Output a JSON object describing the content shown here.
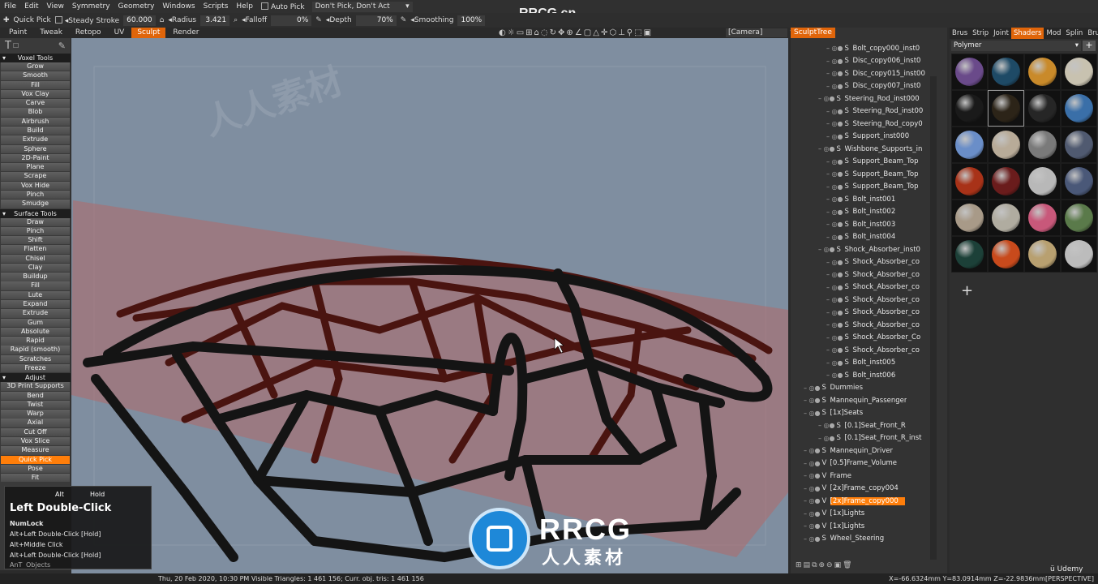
{
  "menubar": {
    "items": [
      "File",
      "Edit",
      "View",
      "Symmetry",
      "Geometry",
      "Windows",
      "Scripts",
      "Help"
    ],
    "auto_pick": "Auto Pick",
    "pick_mode": "Don't Pick, Don't Act"
  },
  "toolbar": {
    "quick_pick": "Quick Pick",
    "steady_stroke": "Steady Stroke",
    "steady_value": "60.000",
    "radius_label": "Radius",
    "radius_value": "3.421",
    "falloff_label": "Falloff",
    "falloff_value": "0%",
    "depth_label": "Depth",
    "depth_value": "70%",
    "smoothing_label": "Smoothing",
    "smoothing_value": "100%"
  },
  "watermark": "RRCG.cn",
  "rooms": [
    "Paint",
    "Tweak",
    "Retopo",
    "UV",
    "Sculpt",
    "Render"
  ],
  "active_room": "Sculpt",
  "camera": "[Camera]",
  "voxel_tools": {
    "title": "Voxel Tools",
    "items": [
      "Grow",
      "Smooth",
      "Fill",
      "Vox Clay",
      "Carve",
      "Blob",
      "Airbrush",
      "Build",
      "Extrude",
      "Sphere",
      "2D-Paint",
      "Plane",
      "Scrape",
      "Vox Hide",
      "Pinch",
      "Smudge"
    ]
  },
  "surface_tools": {
    "title": "Surface Tools",
    "items": [
      "Draw",
      "Pinch",
      "Shift",
      "Flatten",
      "Chisel",
      "Clay",
      "Buildup",
      "Fill",
      "Lute",
      "Expand",
      "Extrude",
      "Gum",
      "Absolute",
      "Rapid",
      "Rapid (smooth)",
      "Scratches",
      "Freeze"
    ]
  },
  "adjust": {
    "title": "Adjust",
    "items": [
      "3D Print Supports",
      "Bend",
      "Twist",
      "Warp",
      "Axial",
      "Cut Off",
      "Vox Slice",
      "Measure",
      "Quick Pick",
      "Pose",
      "Fit"
    ]
  },
  "active_tool": "Quick Pick",
  "hint": {
    "header_left": "Alt",
    "header_right": "Hold",
    "title": "Left Double-Click",
    "lines": [
      "NumLock",
      "Alt+Left Double-Click [Hold]",
      "Alt+Middle Click",
      "Alt+Left Double-Click [Hold]"
    ],
    "footer": "Objects",
    "corner": "AnT"
  },
  "status": {
    "left": "Thu, 20 Feb 2020, 10:30 PM     Visible Triangles: 1 461 156; Curr. obj. tris: 1 461 156",
    "right": "X=-66.6324mm  Y=83.0914mm  Z=-22.9836mm[PERSPECTIVE]"
  },
  "sculpt_tree": {
    "tab": "SculptTree",
    "rows": [
      {
        "name": "Bolt_copy000_inst0",
        "mode": "S",
        "indent": 2
      },
      {
        "name": "Disc_copy006_inst0",
        "mode": "S",
        "indent": 2
      },
      {
        "name": "Disc_copy015_inst00",
        "mode": "S",
        "indent": 2
      },
      {
        "name": "Disc_copy007_inst0",
        "mode": "S",
        "indent": 2
      },
      {
        "name": "Steering_Rod_inst000",
        "mode": "S",
        "indent": 1
      },
      {
        "name": "Steering_Rod_inst00",
        "mode": "S",
        "indent": 2
      },
      {
        "name": "Steering_Rod_copy0",
        "mode": "S",
        "indent": 2
      },
      {
        "name": "Support_inst000",
        "mode": "S",
        "indent": 2
      },
      {
        "name": "Wishbone_Supports_in",
        "mode": "S",
        "indent": 1
      },
      {
        "name": "Support_Beam_Top",
        "mode": "S",
        "indent": 2
      },
      {
        "name": "Support_Beam_Top",
        "mode": "S",
        "indent": 2
      },
      {
        "name": "Support_Beam_Top",
        "mode": "S",
        "indent": 2
      },
      {
        "name": "Bolt_inst001",
        "mode": "S",
        "indent": 2
      },
      {
        "name": "Bolt_inst002",
        "mode": "S",
        "indent": 2
      },
      {
        "name": "Bolt_inst003",
        "mode": "S",
        "indent": 2
      },
      {
        "name": "Bolt_inst004",
        "mode": "S",
        "indent": 2
      },
      {
        "name": "Shock_Absorber_inst0",
        "mode": "S",
        "indent": 1
      },
      {
        "name": "Shock_Absorber_co",
        "mode": "S",
        "indent": 2
      },
      {
        "name": "Shock_Absorber_co",
        "mode": "S",
        "indent": 2
      },
      {
        "name": "Shock_Absorber_co",
        "mode": "S",
        "indent": 2
      },
      {
        "name": "Shock_Absorber_co",
        "mode": "S",
        "indent": 2
      },
      {
        "name": "Shock_Absorber_co",
        "mode": "S",
        "indent": 2
      },
      {
        "name": "Shock_Absorber_co",
        "mode": "S",
        "indent": 2
      },
      {
        "name": "Shock_Absorber_Co",
        "mode": "S",
        "indent": 2
      },
      {
        "name": "Shock_Absorber_co",
        "mode": "S",
        "indent": 2
      },
      {
        "name": "Bolt_inst005",
        "mode": "S",
        "indent": 2
      },
      {
        "name": "Bolt_inst006",
        "mode": "S",
        "indent": 2
      },
      {
        "name": "Dummies",
        "mode": "S",
        "indent": 0
      },
      {
        "name": "Mannequin_Passenger",
        "mode": "S",
        "indent": 0
      },
      {
        "name": "[1x]Seats",
        "mode": "S",
        "indent": 0
      },
      {
        "name": "[0.1]Seat_Front_R",
        "mode": "S",
        "indent": 1
      },
      {
        "name": "[0.1]Seat_Front_R_inst",
        "mode": "S",
        "indent": 1
      },
      {
        "name": "Mannequin_Driver",
        "mode": "S",
        "indent": 0
      },
      {
        "name": "[0.5]Frame_Volume",
        "mode": "V",
        "indent": 0
      },
      {
        "name": "Frame",
        "mode": "V",
        "indent": 0
      },
      {
        "name": "[2x]Frame_copy004",
        "mode": "V",
        "indent": 0
      },
      {
        "name": "[2x]Frame_copy000",
        "mode": "V",
        "indent": 0,
        "selected": true
      },
      {
        "name": "[1x]Lights",
        "mode": "V",
        "indent": 0
      },
      {
        "name": "[1x]Lights",
        "mode": "V",
        "indent": 0
      },
      {
        "name": "Wheel_Steering",
        "mode": "S",
        "indent": 0
      }
    ]
  },
  "shaders": {
    "tabs": [
      "Brus",
      "Strip",
      "Joint",
      "Shaders",
      "Mod",
      "Splin",
      "Brus"
    ],
    "active_tab": "Shaders",
    "filter": "Polymer",
    "swatch_colors": [
      "#6a4a8a",
      "#1e4a66",
      "#c98a2a",
      "#c8c2b0",
      "#1a1a1a",
      "#2c2418",
      "#262626",
      "#3a6fa8",
      "#6a8ec8",
      "#b8ab98",
      "#7a7a7a",
      "#505a70",
      "#a83218",
      "#6a1c1c",
      "#b8b8b8",
      "#4a5878",
      "#a89a88",
      "#b0aca0",
      "#c8587a",
      "#5a7a4a",
      "#1c4038",
      "#c84a1c",
      "#b8a070",
      "#bcbcbc"
    ]
  },
  "brand": {
    "logo_text": "RRCG",
    "logo_sub": "人人素材",
    "udemy": "Udemy"
  }
}
